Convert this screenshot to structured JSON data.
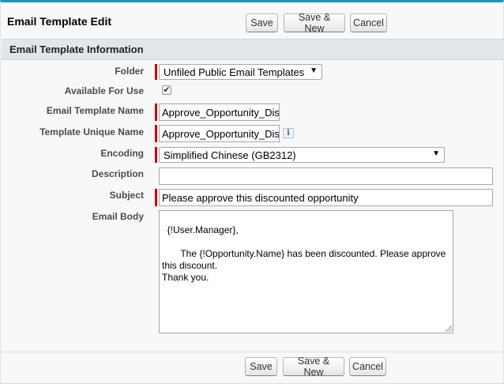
{
  "page": {
    "title": "Email Template Edit"
  },
  "buttons": {
    "save": "Save",
    "save_new": "Save & New",
    "cancel": "Cancel"
  },
  "section": {
    "title": "Email Template Information"
  },
  "fields": {
    "folder": {
      "label": "Folder",
      "value": "Unfiled Public Email Templates"
    },
    "available": {
      "label": "Available For Use",
      "checked": true,
      "mark": "✔"
    },
    "name": {
      "label": "Email Template Name",
      "value": "Approve_Opportunity_Disc"
    },
    "unique_name": {
      "label": "Template Unique Name",
      "value": "Approve_Opportunity_Disc",
      "info": "i"
    },
    "encoding": {
      "label": "Encoding",
      "value": "Simplified Chinese (GB2312)"
    },
    "description": {
      "label": "Description",
      "value": ""
    },
    "subject": {
      "label": "Subject",
      "value": "Please approve this discounted opportunity"
    },
    "body": {
      "label": "Email Body",
      "value": "{!User.Manager},\n\n       The {!Opportunity.Name} has been discounted. Please approve this discount.\nThank you."
    }
  },
  "icons": {
    "dropdown": "▼",
    "info": "info-icon",
    "resize": "resize-handle-icon"
  },
  "colors": {
    "accent": "#1797c0",
    "required": "#cc0000",
    "section_bg": "#e1e6ea"
  }
}
